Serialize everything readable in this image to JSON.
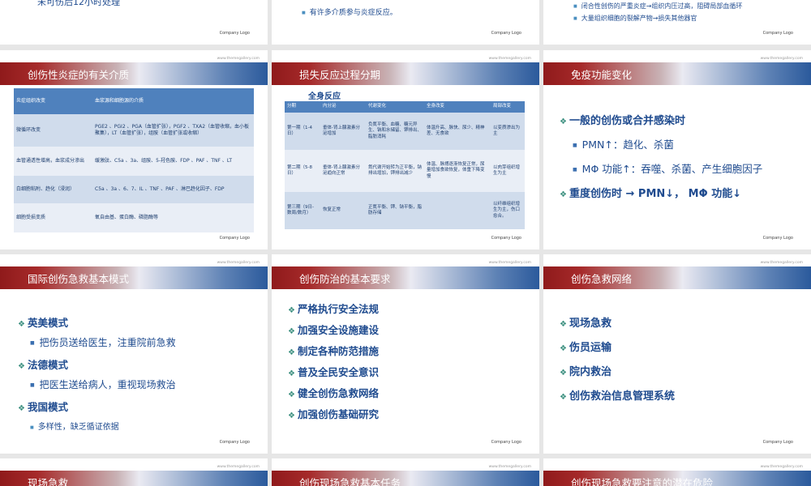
{
  "slides": {
    "r0a": {
      "line": "未可伤后12小时处理",
      "logo": "Company Logo"
    },
    "r0b": {
      "bullet": "有许多介质参与炎症反应。",
      "logo": "Company Logo"
    },
    "r0c": {
      "bullets": [
        "闭合性创伤的严重炎症→组织内压过高，阻碍局部血循环",
        "大量组织细胞的裂解产物→损失其他器官"
      ],
      "logo": "Company Logo"
    },
    "s1": {
      "title": "创伤性炎症的有关介质",
      "url": "www.themegallery.com",
      "logo": "Company Logo",
      "headers": [
        "炎症组织改变",
        "血浆源和细胞源的介质"
      ],
      "rows": [
        [
          "微循环改变",
          "PGE2 、PGI2 、PGA（血管扩张），PGF2 、TXA2（血管收缩，血小板聚集），LT（血管扩张），组胺（血管扩张或收缩）"
        ],
        [
          "血管通透性增高，血浆成分渗出",
          "缓激肽、C5a 、3a、组胺、5-羟色胺、FDP 、PAF 、TNF 、LT"
        ],
        [
          "白细胞粘附、趋化（浸润）",
          "C5a 、3a 、6、7、IL 、TNF 、PAF 、淋巴趋化因子、FDP"
        ],
        [
          "细胞受损变质",
          "氧自由基、蛋白酶、磷脂酶等"
        ]
      ]
    },
    "s2": {
      "title": "损失反应过程分期",
      "url": "www.themegallery.com",
      "logo": "Company Logo",
      "subtitle": "全身反应",
      "headers": [
        "分期",
        "内分泌",
        "代谢变化",
        "全身改变",
        "局部改变"
      ],
      "rows": [
        [
          "第一期（1-4日）",
          "垂体-肾上腺激素分泌增加",
          "负氮平衡、血糖、糖元异生、钠和水储留、钾排出、脂肪消耗",
          "体温升高、脉快、尿少、精神差、无食欲",
          "以变质渗出为主"
        ],
        [
          "第二期（5-8日）",
          "垂体-肾上腺激素分泌趋向正常",
          "氮代谢开始转为正平衡，钠排出增加，钾排出减少",
          "体温、脉搏逐渐恢复正常，尿量增加食欲恢复，体重下降变慢",
          "以肉芽组织增生为主"
        ],
        [
          "第三期（9日-数周/数月）",
          "恢复正常",
          "正氮平衡、钾、钠平衡，脂肪存储",
          "",
          "以纤维组织增生为主，伤口愈合。"
        ]
      ]
    },
    "s3": {
      "title": "免疫功能变化",
      "url": "www.themegallery.com",
      "logo": "Company Logo",
      "l1a": "一般的创伤或合并感染时",
      "l2a": "PMN↑：趋化、杀菌",
      "l2b": "MΦ 功能↑：吞噬、杀菌、产生细胞因子",
      "l1b": "重度创伤时 → PMN↓， MΦ 功能↓"
    },
    "s4": {
      "title": "国际创伤急救基本模式",
      "url": "www.themegallery.com",
      "logo": "Company Logo",
      "h1": "英美模式",
      "d1": "把伤员送给医生，注重院前急救",
      "h2": "法德模式",
      "d2": "把医生送给病人，重视现场救治",
      "h3": "我国模式",
      "d3": "多样性，缺乏循证依据"
    },
    "s5": {
      "title": "创伤防治的基本要求",
      "url": "www.themegallery.com",
      "logo": "Company Logo",
      "items": [
        "严格执行安全法规",
        "加强安全设施建设",
        "制定各种防范措施",
        "普及全民安全意识",
        "健全创伤急救网络",
        "加强创伤基础研究"
      ]
    },
    "s6": {
      "title": "创伤急救网络",
      "url": "www.themegallery.com",
      "logo": "Company Logo",
      "items": [
        "现场急救",
        "伤员运输",
        "院内救治",
        "创伤救治信息管理系统"
      ]
    },
    "r4a": {
      "title": "现场急救",
      "url": "www.themegallery.com"
    },
    "r4b": {
      "title": "创伤现场急救基本任务",
      "url": "www.themegallery.com"
    },
    "r4c": {
      "title": "创伤现场急救要注意的潜在危险",
      "url": "www.themegallery.com"
    }
  },
  "colors": {
    "header_red": "#8f1a1b",
    "header_blue": "#2b5a9c",
    "text_blue": "#1f4b8f",
    "bullet_teal": "#3b8f7f",
    "table_header": "#4f81bd"
  }
}
